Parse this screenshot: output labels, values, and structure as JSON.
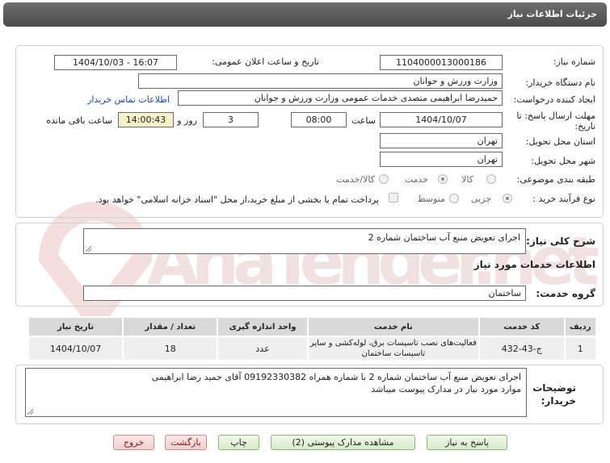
{
  "header": {
    "title": "جزئیات اطلاعات نیاز"
  },
  "form": {
    "need_number_label": "شماره نیاز:",
    "need_number": "1104000013000186",
    "announce_label": "تاریخ و ساعت اعلان عمومی:",
    "announce_value": "1404/10/03 - 16:07",
    "buyer_org_label": "نام دستگاه خریدار:",
    "buyer_org": "وزارت ورزش و جوانان",
    "creator_label": "ایجاد کننده درخواست:",
    "creator": "حمیدرضا ابراهیمی متصدی خدمات عمومی وزارت ورزش و جوانان",
    "contact_link": "اطلاعات تماس خریدار",
    "deadline_label_line1": "مهلت ارسال پاسخ: تا",
    "deadline_label_line2": "تاریخ:",
    "deadline_date": "1404/10/07",
    "time_label": "ساعت",
    "deadline_time": "08:00",
    "days_value": "3",
    "days_label": "روز و",
    "remaining_time": "14:00:43",
    "remaining_label": "ساعت باقی مانده",
    "province_label": "استان محل تحویل:",
    "province": "تهران",
    "city_label": "شهر محل تحویل:",
    "city": "تهران",
    "category_label": "طبقه بندی موضوعی:",
    "category_options": [
      "کالا",
      "خدمت",
      "کالا/خدمت"
    ],
    "category_selected": "خدمت",
    "process_label": "نوع فرآیند خرید :",
    "process_options": [
      "جزیی",
      "متوسط"
    ],
    "process_selected": "جزیی",
    "payment_note": "پرداخت تمام یا بخشی از مبلغ خرید،از محل \"اسناد خزانه اسلامی\" خواهد بود."
  },
  "summary": {
    "label": "شرح کلی نیاز:",
    "text": "اجرای تعویض منبع  آب ساختمان شماره 2"
  },
  "services": {
    "section_title": "اطلاعات خدمات مورد نیاز",
    "group_label": "گروه خدمت:",
    "group_value": "ساختمان",
    "columns": [
      "ردیف",
      "کد خدمت",
      "نام خدمت",
      "واحد اندازه گیری",
      "تعداد / مقدار",
      "تاریخ نیاز"
    ],
    "rows": [
      [
        "1",
        "ج-43-432",
        "فعالیت‌های نصب تاسیسات برق، لوله‌کشی و سایر تاسیسات ساختمان",
        "عدد",
        "18",
        "1404/10/07"
      ]
    ]
  },
  "buyer_notes": {
    "label_line1": "توضیحات",
    "label_line2": "خریدار:",
    "line1": "اجرای تعویض منبع  آب ساختمان شماره 2  با شماره همراه 09192330382 آقای حمید رضا ابراهیمی",
    "line2": "موارد مورد نیاز در مدارک پیوست میباشد"
  },
  "buttons": {
    "respond": "پاسخ به نیاز",
    "attachments": "مشاهده مدارک پیوستی (2)",
    "print": "چاپ",
    "back": "بازگشت",
    "exit": "خروج"
  },
  "watermark": {
    "text": "AriaTender.net"
  },
  "colors": {
    "title_bar": "#5a5a5a",
    "link": "#1f4bb8",
    "remaining_bg": "#f5f1c8",
    "watermark": "#f2dede"
  }
}
